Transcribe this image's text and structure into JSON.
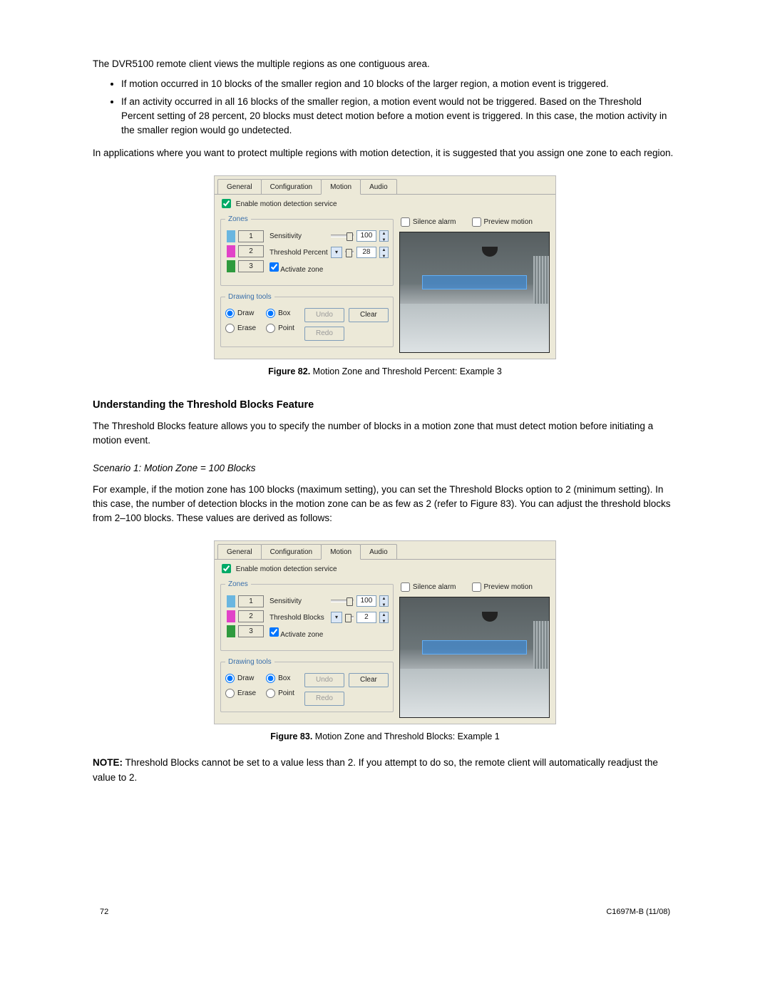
{
  "intro": "The DVR5100 remote client views the multiple regions as one contiguous area.",
  "bullets": [
    "If motion occurred in 10 blocks of the smaller region and 10 blocks of the larger region, a motion event is triggered.",
    "If an activity occurred in all 16 blocks of the smaller region, a motion event would not be triggered. Based on the Threshold Percent setting of 28 percent, 20 blocks must detect motion before a motion event is triggered. In this case, the motion activity in the smaller region would go undetected."
  ],
  "after_bullets": "In applications where you want to protect multiple regions with motion detection, it is suggested that you assign one zone to each region.",
  "figure82": {
    "label": "Figure 82.",
    "text": "  Motion Zone and Threshold Percent: Example 3"
  },
  "section_head": "Understanding the Threshold Blocks Feature",
  "section_p1": "The Threshold Blocks feature allows you to specify the number of blocks in a motion zone that must detect motion before initiating a motion event.",
  "scenario_head": "Scenario 1: Motion Zone = 100 Blocks",
  "section_p2": "For example, if the motion zone has 100 blocks (maximum setting), you can set the Threshold Blocks option to 2 (minimum setting). In this case, the number of detection blocks in the motion zone can be as few as 2 (refer to Figure 83). You can adjust the threshold blocks from 2–100 blocks. These values are derived as follows:",
  "figure83": {
    "label": "Figure 83.",
    "text": "  Motion Zone and Threshold Blocks: Example 1"
  },
  "note_label": "NOTE:",
  "note_text": "  Threshold Blocks cannot be set to a value less than 2.  If you attempt to do so, the remote client will automatically readjust the value to 2.",
  "page_num": "72",
  "doc_id": "C1697M-B (11/08)",
  "ui": {
    "tabs": {
      "general": "General",
      "configuration": "Configuration",
      "motion": "Motion",
      "audio": "Audio"
    },
    "enable_label": "Enable motion detection service",
    "zones_legend": "Zones",
    "zone_labels": [
      "1",
      "2",
      "3"
    ],
    "sensitivity_label": "Sensitivity",
    "activate_label": "Activate zone",
    "drawing_legend": "Drawing tools",
    "radio": {
      "draw": "Draw",
      "erase": "Erase",
      "box": "Box",
      "point": "Point"
    },
    "buttons": {
      "undo": "Undo",
      "redo": "Redo",
      "clear": "Clear"
    },
    "right": {
      "silence": "Silence alarm",
      "preview": "Preview motion"
    },
    "panel82": {
      "threshold_label": "Threshold Percent",
      "sensitivity": "100",
      "threshold": "28"
    },
    "panel83": {
      "threshold_label": "Threshold Blocks",
      "sensitivity": "100",
      "threshold": "2"
    }
  }
}
